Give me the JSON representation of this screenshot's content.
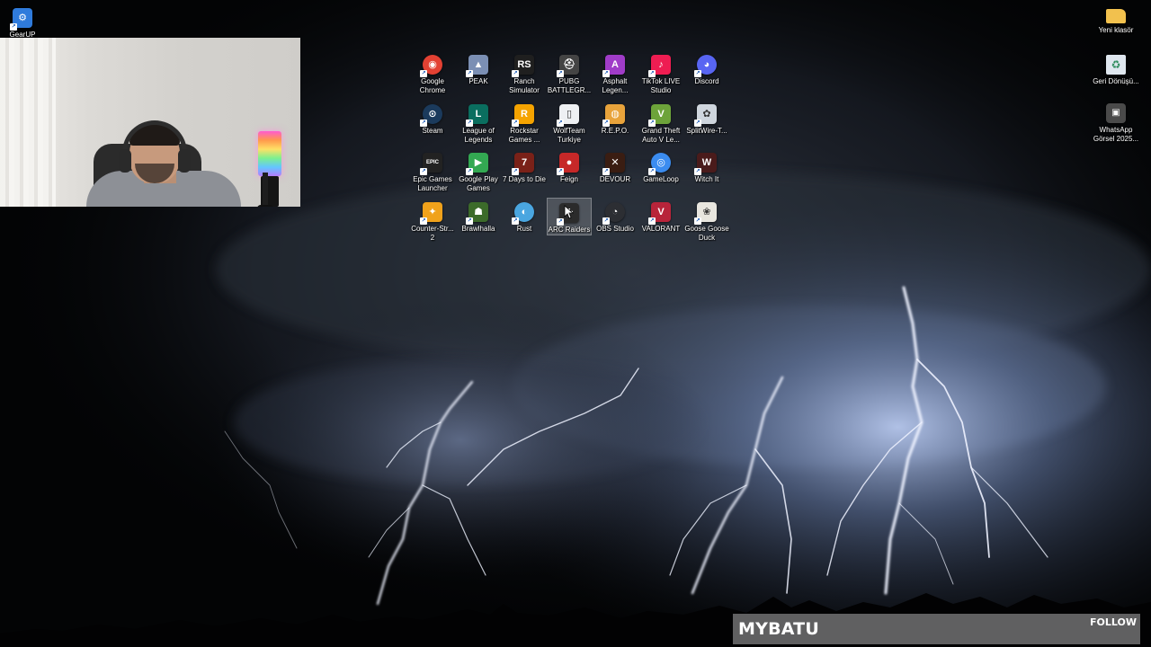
{
  "desktop": {
    "wallpaper": "thunderstorm-lightning",
    "colors": {
      "sky_top": "#050608",
      "cloud": "#3a4150",
      "lightning": "#e9eeff",
      "glow": "#8fa6d8"
    }
  },
  "left_icons": [
    {
      "label": "GearUP",
      "icon": "gearup-icon",
      "color": "#2f7bdc"
    }
  ],
  "right_icons": [
    {
      "label": "Yeni klasör",
      "icon": "folder-icon",
      "color": "#f2c14e"
    },
    {
      "label": "Geri Dönüşü...",
      "icon": "recycle-bin-icon",
      "color": "#dfe7ef"
    },
    {
      "label": "WhatsApp Görsel 2025...",
      "icon": "image-file-icon",
      "color": "#4a4a4a"
    }
  ],
  "grid_icons": [
    [
      {
        "label": "Google Chrome",
        "icon": "chrome-icon",
        "color": "#e34133",
        "glyph": "◉"
      },
      {
        "label": "PEAK",
        "icon": "peak-icon",
        "color": "#7b8fb4",
        "glyph": "▲"
      },
      {
        "label": "Ranch Simulator",
        "icon": "ranch-simulator-icon",
        "color": "#1f1f1f",
        "glyph": "RS"
      },
      {
        "label": "PUBG BATTLEGR...",
        "icon": "pubg-icon",
        "color": "#444444",
        "glyph": "⛑"
      },
      {
        "label": "Asphalt Legen...",
        "icon": "asphalt-icon",
        "color": "#a03cc8",
        "glyph": "A"
      },
      {
        "label": "TikTok LIVE Studio",
        "icon": "tiktok-live-icon",
        "color": "#ee1d52",
        "glyph": "♪"
      },
      {
        "label": "Discord",
        "icon": "discord-icon",
        "color": "#5865f2",
        "glyph": "◕"
      }
    ],
    [
      {
        "label": "Steam",
        "icon": "steam-icon",
        "color": "#1b3a5c",
        "glyph": "⊙"
      },
      {
        "label": "League of Legends",
        "icon": "league-of-legends-icon",
        "color": "#0a6e5f",
        "glyph": "L"
      },
      {
        "label": "Rockstar Games ...",
        "icon": "rockstar-icon",
        "color": "#f5a300",
        "glyph": "R"
      },
      {
        "label": "WolfTeam Turkiye",
        "icon": "wolfteam-file-icon",
        "color": "#eef0f3",
        "glyph": "▯"
      },
      {
        "label": "R.E.P.O.",
        "icon": "repo-icon",
        "color": "#e8a33b",
        "glyph": "◍"
      },
      {
        "label": "Grand Theft Auto V Le...",
        "icon": "gta-v-icon",
        "color": "#6da33a",
        "glyph": "V"
      },
      {
        "label": "SplitWire-T...",
        "icon": "splitwire-icon",
        "color": "#cfd6de",
        "glyph": "✿"
      }
    ],
    [
      {
        "label": "Epic Games Launcher",
        "icon": "epic-games-icon",
        "color": "#222222",
        "glyph": "EPIC"
      },
      {
        "label": "Google Play Games",
        "icon": "google-play-games-icon",
        "color": "#33a852",
        "glyph": "▶"
      },
      {
        "label": "7 Days to Die",
        "icon": "7-days-to-die-icon",
        "color": "#7a2118",
        "glyph": "7"
      },
      {
        "label": "Feign",
        "icon": "feign-icon",
        "color": "#c62828",
        "glyph": "●"
      },
      {
        "label": "DEVOUR",
        "icon": "devour-icon",
        "color": "#3a1d12",
        "glyph": "✕"
      },
      {
        "label": "GameLoop",
        "icon": "gameloop-icon",
        "color": "#3b8cf0",
        "glyph": "◎"
      },
      {
        "label": "Witch It",
        "icon": "witch-it-icon",
        "color": "#4a1b1b",
        "glyph": "W"
      }
    ],
    [
      {
        "label": "Counter-Str... 2",
        "icon": "counter-strike-2-icon",
        "color": "#f0a21b",
        "glyph": "✦"
      },
      {
        "label": "Brawlhalla",
        "icon": "brawlhalla-icon",
        "color": "#3c6b2a",
        "glyph": "☗"
      },
      {
        "label": "Rust",
        "icon": "rust-icon",
        "color": "#4aa6e0",
        "glyph": "◐"
      },
      {
        "label": "ARC Raiders",
        "icon": "arc-raiders-icon",
        "color": "#2b2b2b",
        "glyph": "✚"
      },
      {
        "label": "OBS Studio",
        "icon": "obs-studio-icon",
        "color": "#2c2e33",
        "glyph": "◔"
      },
      {
        "label": "VALORANT",
        "icon": "valorant-icon",
        "color": "#b8243a",
        "glyph": "V"
      },
      {
        "label": "Goose Goose Duck",
        "icon": "goose-goose-duck-icon",
        "color": "#e8e6df",
        "glyph": "❀"
      }
    ]
  ],
  "selected_icon": "ARC Raiders",
  "stream_overlay": {
    "channel_name": "MYBATU",
    "follow_label": "FOLLOW"
  }
}
